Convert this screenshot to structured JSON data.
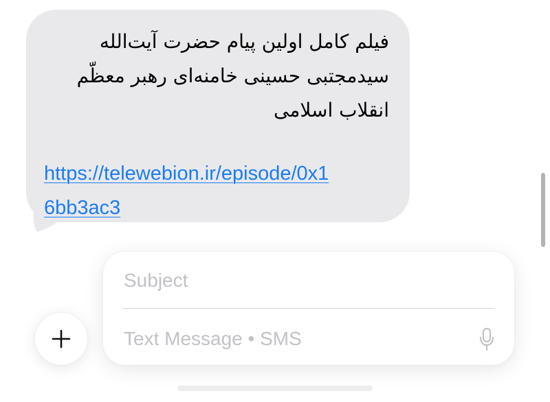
{
  "message": {
    "text": "فیلم کامل اولین پیام حضرت آیت‌الله سیدمجتبی حسینی خامنه‌ای رهبر معظّم انقلاب اسلامی",
    "link": "https://telewebion.ir/episode/0x16bb3ac3"
  },
  "compose": {
    "subject_placeholder": "Subject",
    "message_placeholder": "Text Message • SMS",
    "add_icon": "plus-icon",
    "mic_icon": "microphone-icon"
  },
  "colors": {
    "bubble": "#e9e9eb",
    "link": "#1a7cf5",
    "placeholder": "#c2c2c6"
  }
}
